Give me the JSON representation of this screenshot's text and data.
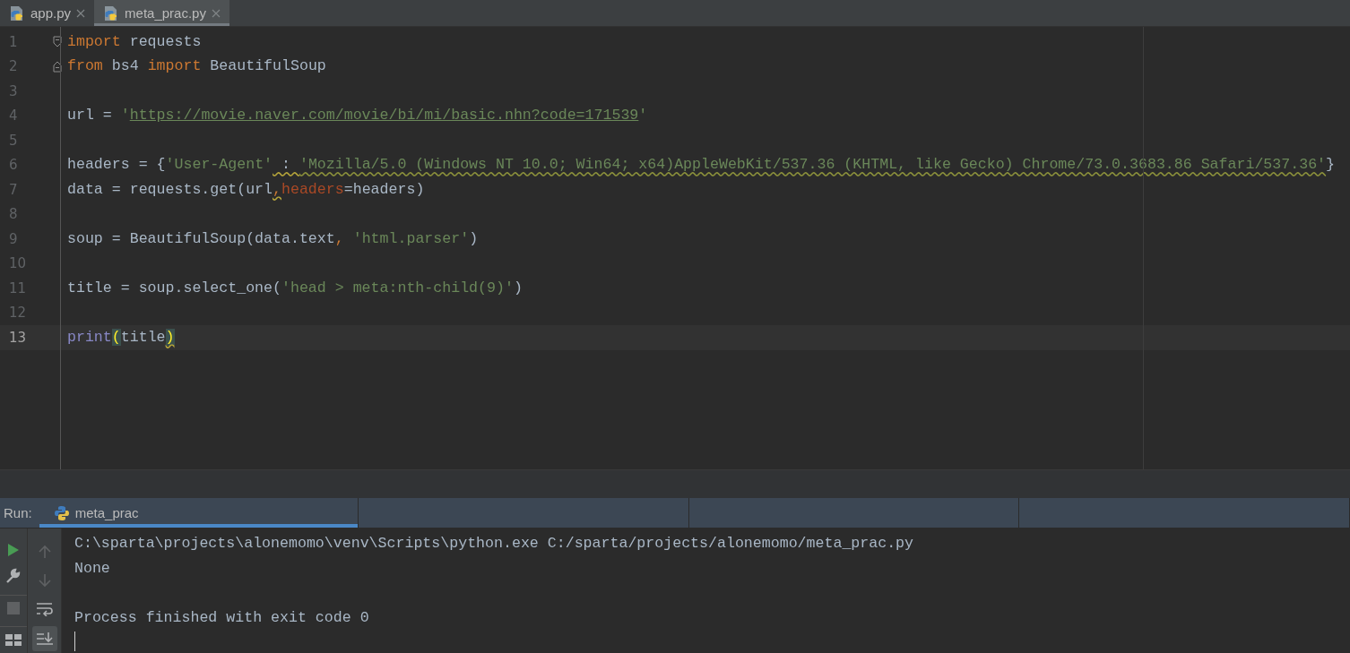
{
  "editor_tabs": [
    {
      "label": "app.py",
      "selected": false
    },
    {
      "label": "meta_prac.py",
      "selected": true
    }
  ],
  "editor": {
    "lines": [
      {
        "number": "1",
        "current": false,
        "kind": "fold-start",
        "tokens": [
          {
            "text": "import",
            "kind": "keyword"
          },
          {
            "text": " requests",
            "kind": "text"
          }
        ]
      },
      {
        "number": "2",
        "current": false,
        "kind": "fold-end",
        "tokens": [
          {
            "text": "from",
            "kind": "keyword"
          },
          {
            "text": " bs4 ",
            "kind": "text"
          },
          {
            "text": "import",
            "kind": "keyword"
          },
          {
            "text": " BeautifulSoup",
            "kind": "text"
          }
        ]
      },
      {
        "number": "3",
        "current": false
      },
      {
        "number": "4",
        "current": false,
        "tokens": [
          {
            "text": "url = ",
            "kind": "text"
          },
          {
            "text": "'",
            "kind": "string"
          },
          {
            "text": "https://movie.naver.com/movie/bi/mi/basic.nhn?code=171539",
            "kind": "link"
          },
          {
            "text": "'",
            "kind": "string"
          }
        ]
      },
      {
        "number": "5",
        "current": false
      },
      {
        "number": "6",
        "current": false,
        "tokens": [
          {
            "text": "headers = {",
            "kind": "text"
          },
          {
            "text": "'User-Agent'",
            "kind": "string"
          },
          {
            "text": " : ",
            "kind": "warn"
          },
          {
            "text": "'Mozilla/5.0 (Windows NT 10.0; Win64; x64)AppleWebKit/537.36 (KHTML, like Gecko) Chrome/73.0.3683.86 Safari/537.36'",
            "kind": "typo"
          },
          {
            "text": "}",
            "kind": "text"
          }
        ]
      },
      {
        "number": "7",
        "current": false,
        "tokens": [
          {
            "text": "data = requests.get(url",
            "kind": "text"
          },
          {
            "text": ",",
            "kind": "comma-warn"
          },
          {
            "text": "headers",
            "kind": "param"
          },
          {
            "text": "=headers)",
            "kind": "text"
          }
        ]
      },
      {
        "number": "8",
        "current": false
      },
      {
        "number": "9",
        "current": false,
        "tokens": [
          {
            "text": "soup = BeautifulSoup(data.text",
            "kind": "text"
          },
          {
            "text": ", ",
            "kind": "comma"
          },
          {
            "text": "'html.parser'",
            "kind": "string"
          },
          {
            "text": ")",
            "kind": "text"
          }
        ]
      },
      {
        "number": "10",
        "current": false
      },
      {
        "number": "11",
        "current": false,
        "tokens": [
          {
            "text": "title = soup.select_one(",
            "kind": "text"
          },
          {
            "text": "'head > meta:nth-child(9)'",
            "kind": "string"
          },
          {
            "text": ")",
            "kind": "text"
          }
        ]
      },
      {
        "number": "12",
        "current": false
      },
      {
        "number": "13",
        "current": true,
        "tokens": [
          {
            "text": "print",
            "kind": "builtin"
          },
          {
            "text": "(",
            "kind": "match"
          },
          {
            "text": "title",
            "kind": "text"
          },
          {
            "text": ")",
            "kind": "match-warn"
          }
        ]
      }
    ]
  },
  "run_panel": {
    "label": "Run:",
    "tab": {
      "label": "meta_prac",
      "selected": true
    },
    "output": [
      [
        "C:\\sparta\\projects\\alonemomo\\venv\\Scripts\\python.exe C:/sparta/projects/alonemomo/meta_prac.py",
        "None"
      ],
      [
        "Process finished with exit code 0"
      ]
    ]
  }
}
